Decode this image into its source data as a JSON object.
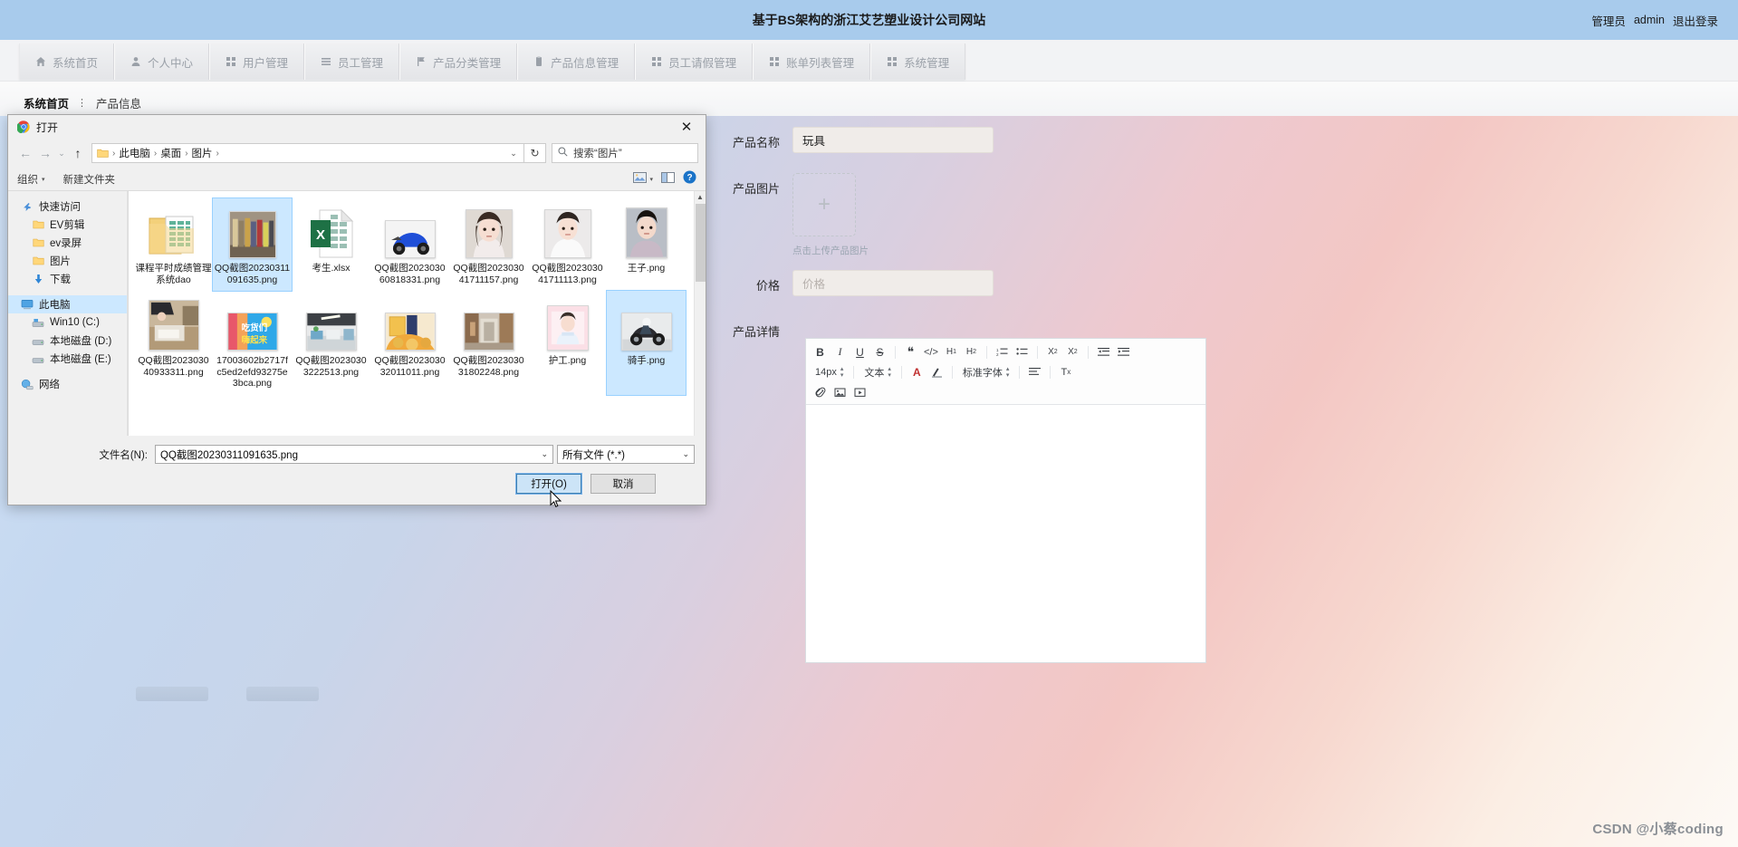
{
  "header": {
    "site_title": "基于BS架构的浙江艾艺塑业设计公司网站",
    "role_label": "管理员",
    "user_name": "admin",
    "logout_label": "退出登录",
    "bg_color": "#a8cbec"
  },
  "nav": {
    "items": [
      {
        "label": "系统首页",
        "icon": "home-icon"
      },
      {
        "label": "个人中心",
        "icon": "user-icon"
      },
      {
        "label": "用户管理",
        "icon": "grid-icon"
      },
      {
        "label": "员工管理",
        "icon": "list-icon"
      },
      {
        "label": "产品分类管理",
        "icon": "flag-icon"
      },
      {
        "label": "产品信息管理",
        "icon": "document-icon"
      },
      {
        "label": "员工请假管理",
        "icon": "grid-icon"
      },
      {
        "label": "账单列表管理",
        "icon": "grid-icon"
      },
      {
        "label": "系统管理",
        "icon": "grid-icon"
      }
    ]
  },
  "breadcrumb": {
    "root": "系统首页",
    "separator": "⋮",
    "current": "产品信息"
  },
  "form": {
    "product_name_label": "产品名称",
    "product_name_value": "玩具",
    "product_image_label": "产品图片",
    "upload_plus": "+",
    "upload_hint": "点击上传产品图片",
    "price_label": "价格",
    "price_placeholder": "价格",
    "detail_label": "产品详情"
  },
  "editor": {
    "font_size": "14px",
    "text_label": "文本",
    "font_family": "标准字体",
    "buttons": [
      "bold",
      "italic",
      "underline",
      "strikethrough",
      "blockquote",
      "code",
      "heading-1",
      "heading-2",
      "ordered-list",
      "unordered-list",
      "subscript",
      "superscript",
      "outdent",
      "indent",
      "text-color",
      "background-color",
      "align",
      "clear-format",
      "link",
      "image",
      "video"
    ]
  },
  "dialog": {
    "title": "打开",
    "title_icon": "chrome-icon",
    "close_icon": "✕",
    "nav": {
      "back_icon": "←",
      "forward_icon": "→",
      "recent_icon": "⌄",
      "up_icon": "↑",
      "refresh_icon": "↻",
      "dropdown_icon": "⌄"
    },
    "address_path": [
      "此电脑",
      "桌面",
      "图片"
    ],
    "search_placeholder": "搜索“图片”",
    "search_icon": "search-icon",
    "toolbar": {
      "organize_label": "组织",
      "organize_caret": "▾",
      "new_folder_label": "新建文件夹",
      "view_icon": "view-icon",
      "view_caret": "▾",
      "pane_icon": "preview-pane-icon",
      "help_icon": "?"
    },
    "sidebar": [
      {
        "label": "快速访问",
        "icon": "pin-icon",
        "indent": false,
        "selected": false
      },
      {
        "label": "EV剪辑",
        "icon": "folder-icon",
        "indent": true,
        "selected": false
      },
      {
        "label": "ev录屏",
        "icon": "folder-icon",
        "indent": true,
        "selected": false
      },
      {
        "label": "图片",
        "icon": "folder-icon",
        "indent": true,
        "selected": false
      },
      {
        "label": "下载",
        "icon": "download-icon",
        "indent": true,
        "selected": false
      },
      {
        "label": "此电脑",
        "icon": "computer-icon",
        "indent": false,
        "selected": true
      },
      {
        "label": "Win10 (C:)",
        "icon": "drive-system-icon",
        "indent": true,
        "selected": false
      },
      {
        "label": "本地磁盘 (D:)",
        "icon": "drive-icon",
        "indent": true,
        "selected": false
      },
      {
        "label": "本地磁盘 (E:)",
        "icon": "drive-icon",
        "indent": true,
        "selected": false
      },
      {
        "label": "网络",
        "icon": "network-icon",
        "indent": false,
        "selected": false
      }
    ],
    "files": [
      {
        "name": "课程平时成绩管理系统dao",
        "type": "folder",
        "selected": false
      },
      {
        "name": "QQ截图20230311091635.png",
        "type": "image",
        "selected": true
      },
      {
        "name": "考生.xlsx",
        "type": "excel",
        "selected": false
      },
      {
        "name": "QQ截图202303060818331.png",
        "type": "image",
        "selected": false
      },
      {
        "name": "QQ截图202303041711157.png",
        "type": "image",
        "selected": false
      },
      {
        "name": "QQ截图202303041711113.png",
        "type": "image",
        "selected": false
      },
      {
        "name": "王子.png",
        "type": "image",
        "selected": false
      },
      {
        "name": "QQ截图202303040933311.png",
        "type": "image",
        "selected": false
      },
      {
        "name": "17003602b2717fc5ed2efd93275e3bca.png",
        "type": "image",
        "selected": false
      },
      {
        "name": "QQ截图20230303222513.png",
        "type": "image",
        "selected": false
      },
      {
        "name": "QQ截图202303032011011.png",
        "type": "image",
        "selected": false
      },
      {
        "name": "QQ截图202303031802248.png",
        "type": "image",
        "selected": false
      },
      {
        "name": "护工.png",
        "type": "image",
        "selected": false
      },
      {
        "name": "骑手.png",
        "type": "image",
        "selected": true
      }
    ],
    "file_name_label": "文件名(N):",
    "file_name_value": "QQ截图20230311091635.png",
    "filter_value": "所有文件 (*.*)",
    "open_button": "打开(O)",
    "cancel_button": "取消"
  },
  "watermark": "CSDN @小蔡coding"
}
